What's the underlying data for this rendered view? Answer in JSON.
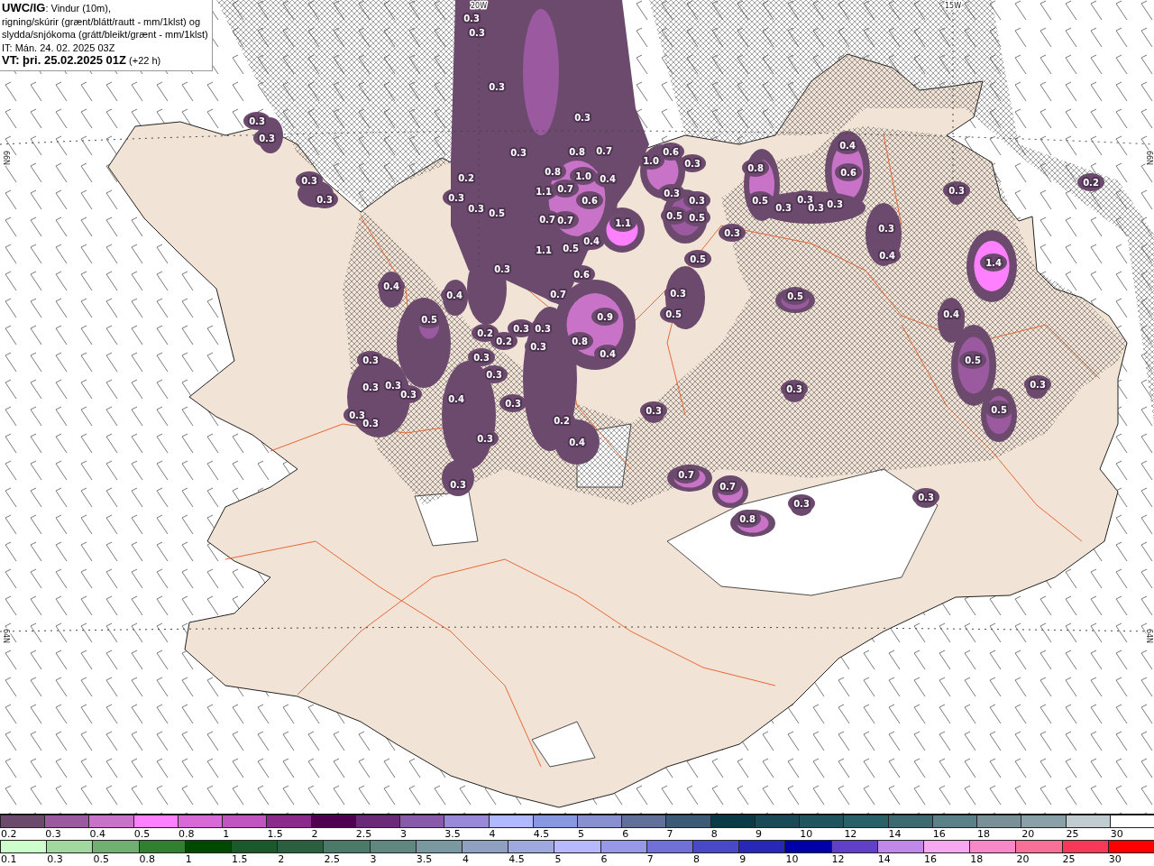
{
  "caption": {
    "lines": [
      "**UWC/IG**: Vindur (10m),",
      "rigning/skúrir (grænt/blátt/rautt - mm/1klst) og",
      "slydda/snjókoma (grátt/bleikt/grænt - mm/1klst)",
      "IT: Mán. 24. 02. 2025 03Z",
      "**VT: þri. 25.02.2025 01Z** (+22 h)"
    ]
  },
  "map": {
    "grid_labels": [
      "20W",
      "15W",
      "66N",
      "66N",
      "64N",
      "64N"
    ],
    "values": [
      "0.3",
      "0.3",
      "0.3",
      "0.3",
      "0.3",
      "0.8",
      "0.7",
      "1.0",
      "0.6",
      "0.4",
      "0.3",
      "0.3",
      "0.2",
      "0.8",
      "1.0",
      "0.4",
      "0.8",
      "0.6",
      "0.3",
      "0.3",
      "0.3",
      "0.2",
      "0.3",
      "1.1",
      "0.7",
      "0.6",
      "0.3",
      "0.3",
      "0.5",
      "0.3",
      "0.3",
      "0.3",
      "0.3",
      "0.3",
      "0.3",
      "0.5",
      "0.7",
      "0.7",
      "1.1",
      "0.5",
      "0.5",
      "0.3",
      "0.3",
      "0.4",
      "1.1",
      "0.5",
      "0.4",
      "1.4",
      "0.5",
      "0.3",
      "0.6",
      "0.4",
      "0.4",
      "0.7",
      "0.3",
      "0.5",
      "0.4",
      "0.5",
      "0.9",
      "0.5",
      "0.3",
      "0.3",
      "0.2",
      "0.2",
      "0.8",
      "0.3",
      "0.3",
      "0.4",
      "0.3",
      "0.5",
      "0.3",
      "0.3",
      "0.3",
      "0.3",
      "0.3",
      "0.3",
      "0.4",
      "0.3",
      "0.3",
      "0.5",
      "0.3",
      "0.3",
      "0.2",
      "0.3",
      "0.4",
      "0.7",
      "0.3",
      "0.7",
      "0.3",
      "0.3",
      "0.8"
    ]
  },
  "legend": {
    "snow": [
      {
        "label": "0.2",
        "color": "#6b4a6e"
      },
      {
        "label": "0.3",
        "color": "#9b5a9f"
      },
      {
        "label": "0.4",
        "color": "#c872c8"
      },
      {
        "label": "0.5",
        "color": "#ff80ff"
      },
      {
        "label": "0.8",
        "color": "#d86ad8"
      },
      {
        "label": "1",
        "color": "#c055c0"
      },
      {
        "label": "1.5",
        "color": "#8a2a8a"
      },
      {
        "label": "2",
        "color": "#500050"
      },
      {
        "label": "2.5",
        "color": "#6a2a78"
      },
      {
        "label": "3",
        "color": "#8a5aaa"
      },
      {
        "label": "3.5",
        "color": "#9a88d8"
      },
      {
        "label": "4",
        "color": "#b0b8ff"
      },
      {
        "label": "4.5",
        "color": "#8898e0"
      },
      {
        "label": "5",
        "color": "#8890d0"
      },
      {
        "label": "6",
        "color": "#607098"
      },
      {
        "label": "7",
        "color": "#3a5a78"
      },
      {
        "label": "8",
        "color": "#0a3a48"
      },
      {
        "label": "9",
        "color": "#1a4a58"
      },
      {
        "label": "10",
        "color": "#205560"
      },
      {
        "label": "12",
        "color": "#2a6068"
      },
      {
        "label": "14",
        "color": "#3d6a70"
      },
      {
        "label": "16",
        "color": "#5a8088"
      },
      {
        "label": "18",
        "color": "#7a9098"
      },
      {
        "label": "20",
        "color": "#8aa0a8"
      },
      {
        "label": "25",
        "color": "#c0cccf"
      },
      {
        "label": "30",
        "color": "#ffffff"
      }
    ],
    "rain": [
      {
        "label": "0.1",
        "color": "#ccffcc"
      },
      {
        "label": "0.3",
        "color": "#a0d8a0"
      },
      {
        "label": "0.5",
        "color": "#70b070"
      },
      {
        "label": "0.8",
        "color": "#308030"
      },
      {
        "label": "1",
        "color": "#004a00"
      },
      {
        "label": "1.5",
        "color": "#1a5a2a"
      },
      {
        "label": "2",
        "color": "#2a6040"
      },
      {
        "label": "2.5",
        "color": "#4a7a68"
      },
      {
        "label": "3",
        "color": "#608880"
      },
      {
        "label": "3.5",
        "color": "#7a98a0"
      },
      {
        "label": "4",
        "color": "#8fa0c0"
      },
      {
        "label": "4.5",
        "color": "#a0a8e0"
      },
      {
        "label": "5",
        "color": "#b8b8ff"
      },
      {
        "label": "6",
        "color": "#9898e8"
      },
      {
        "label": "7",
        "color": "#7070d8"
      },
      {
        "label": "8",
        "color": "#4848c8"
      },
      {
        "label": "9",
        "color": "#2828b8"
      },
      {
        "label": "10",
        "color": "#0000a8"
      },
      {
        "label": "12",
        "color": "#6040c8"
      },
      {
        "label": "14",
        "color": "#c088e8"
      },
      {
        "label": "16",
        "color": "#f8a8f0"
      },
      {
        "label": "18",
        "color": "#f888c8"
      },
      {
        "label": "20",
        "color": "#f87098"
      },
      {
        "label": "25",
        "color": "#f83858"
      },
      {
        "label": "30",
        "color": "#ff0000"
      }
    ]
  }
}
